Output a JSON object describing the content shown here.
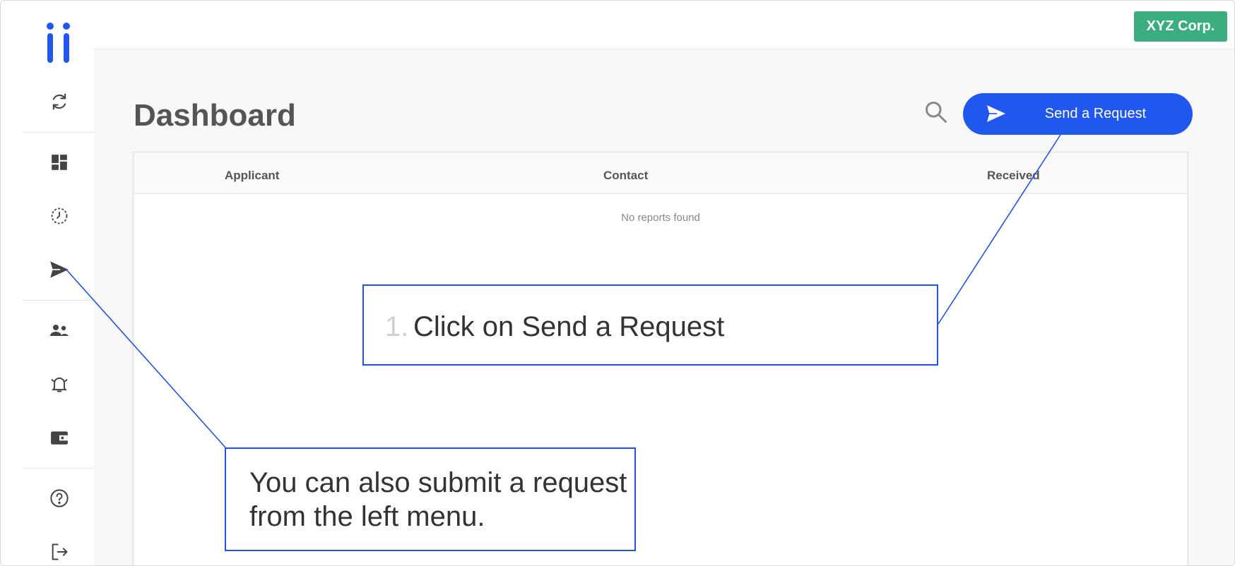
{
  "app": {
    "org_name": "XYZ Corp.",
    "accent_color": "#2057ee",
    "org_badge_color": "#3aae7f",
    "annotation_color": "#2451e0"
  },
  "sidebar": {
    "items": [
      {
        "icon": "refresh-icon"
      },
      {
        "icon": "dashboard-icon"
      },
      {
        "icon": "clock-icon"
      },
      {
        "icon": "send-icon"
      },
      {
        "icon": "people-icon"
      },
      {
        "icon": "bell-icon"
      },
      {
        "icon": "wallet-icon"
      },
      {
        "icon": "help-icon"
      },
      {
        "icon": "logout-icon"
      }
    ]
  },
  "main": {
    "title": "Dashboard",
    "send_button_label": "Send a Request",
    "table": {
      "columns": [
        "Applicant",
        "Contact",
        "Received"
      ],
      "empty_message": "No reports found"
    }
  },
  "annotations": {
    "step1_number": "1.",
    "step1_text": "Click on Send a Request",
    "note_text": "You can also submit a request from the left menu."
  }
}
